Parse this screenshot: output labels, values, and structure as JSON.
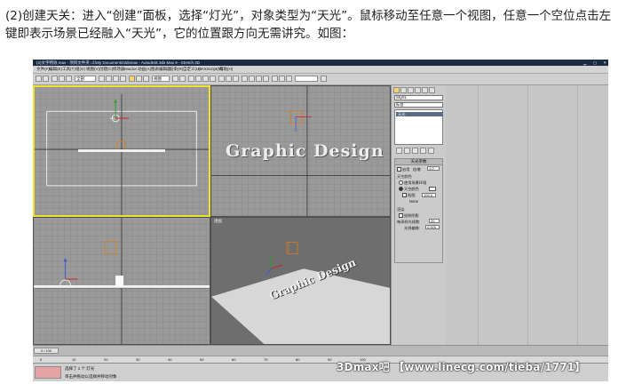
{
  "caption": {
    "line1": "(2)创建天关：进入“创建”面板，选择“灯光”，对象类型为“天光”。鼠标移动至任意一个视图，任意一个空位点击左",
    "line2": "键即表示场景已经融入“天光”，它的位置跟方向无需讲究。如图："
  },
  "app": {
    "title": "(2)文字特效.max - 项目文件夹: d:\\My Documents\\3dsmax - Autodesk 3ds Max 9 - Stretch 3D",
    "menus": [
      "文件(F)",
      "编辑(E)",
      "工具(T)",
      "组(G)",
      "视图(V)",
      "创建(C)",
      "修改器",
      "reactor",
      "动画(A)",
      "图表编辑器",
      "渲染(R)",
      "自定义(U)",
      "MAXScript(M)",
      "帮助(H)"
    ],
    "toolbar": {
      "selection_filter": "全部",
      "ref_coord": "视图"
    }
  },
  "viewports": {
    "top": "",
    "front": "",
    "left": "",
    "perspective": "透视",
    "scene_text": "Graphic Design"
  },
  "command_panel": {
    "object_name": "Sky01",
    "category_dropdown": "标准",
    "list_selected": "天光",
    "params_title": "天光参数",
    "on_label": "启用",
    "multiplier_label": "倍增:",
    "multiplier_value": "1.0",
    "sky_color_label": "天空颜色",
    "use_scene_env": "使用场景环境",
    "sky_color_opt": "天空颜色",
    "map_label": "贴图:",
    "map_value": "100.0",
    "map_none": "None",
    "render_label": "渲染",
    "cast_shadows": "投射阴影",
    "rays_label": "每采样光线数:",
    "rays_value": "20",
    "ray_bias_label": "光线偏移:",
    "ray_bias_value": "0.005"
  },
  "timeline": {
    "ticks": [
      "0",
      "10",
      "20",
      "30",
      "40",
      "50",
      "60",
      "70",
      "80",
      "90",
      "100"
    ],
    "frame": "0 / 100"
  },
  "status": {
    "selection": "选择了 1 个 灯光",
    "prompt": "单击并拖动以选择并移动对象"
  },
  "watermark": "3Dmax吧 【www.linecg.com/tieba/1771】",
  "colors": {
    "active_border": "#f0e330",
    "viewport_bg": "#9a9a9a",
    "persp_bg": "#6e6e6e",
    "selected_item": "#5a6a8a"
  }
}
